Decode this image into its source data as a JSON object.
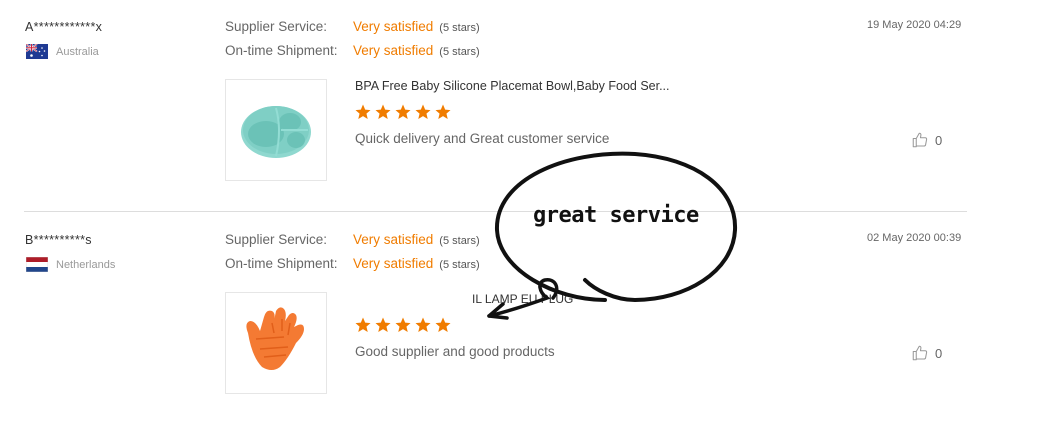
{
  "reviews": [
    {
      "reviewer": "A************x",
      "country": "Australia",
      "supplier_service_label": "Supplier Service:",
      "supplier_service_value": "Very satisfied",
      "supplier_service_stars": "(5 stars)",
      "shipment_label": "On-time Shipment:",
      "shipment_value": "Very satisfied",
      "shipment_stars": "(5 stars)",
      "date": "19 May 2020 04:29",
      "product_title": "BPA Free Baby Silicone Placemat Bowl,Baby Food Ser...",
      "rating": 5,
      "comment": "Quick delivery and Great customer service",
      "likes": "0",
      "product_icon": "silicone-plate-icon"
    },
    {
      "reviewer": "B**********s",
      "country": "Netherlands",
      "supplier_service_label": "Supplier Service:",
      "supplier_service_value": "Very satisfied",
      "supplier_service_stars": "(5 stars)",
      "shipment_label": "On-time Shipment:",
      "shipment_value": "Very satisfied",
      "shipment_stars": "(5 stars)",
      "date": "02 May 2020 00:39",
      "product_title": "IL LAMP EU PLUG",
      "rating": 5,
      "comment": "Good supplier and good products",
      "likes": "0",
      "product_icon": "silicone-glove-icon"
    }
  ],
  "annotation": {
    "text": "great service"
  },
  "colors": {
    "accent": "#f07c00",
    "star": "#f07c00",
    "divider": "#dddddd"
  }
}
